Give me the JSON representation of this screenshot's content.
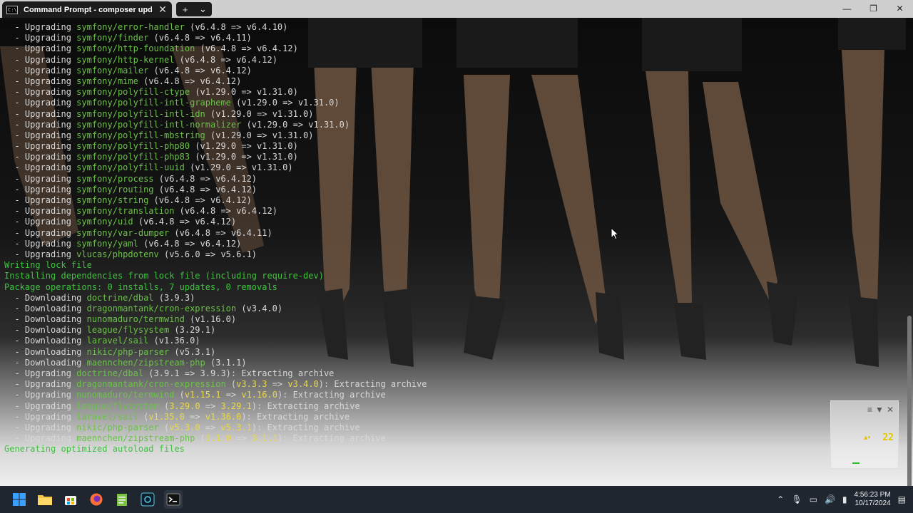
{
  "window": {
    "tab_title": "Command Prompt - composer  update",
    "tab_icon_text": "C:\\",
    "tab_close": "✕",
    "new_tab": "+",
    "tab_menu": "⌄",
    "minimize": "—",
    "maximize": "❐",
    "close": "✕"
  },
  "colors": {
    "package_green": "#6cc14a",
    "status_green": "#3fc33f",
    "version_yellow": "#e8d84a",
    "text_white": "#d8d8d8"
  },
  "terminal": {
    "lines": [
      [
        {
          "t": "  - Upgrading ",
          "c": "w"
        },
        {
          "t": "symfony/error-handler",
          "c": "g"
        },
        {
          "t": " (v6.4.8 => v6.4.10)",
          "c": "w"
        }
      ],
      [
        {
          "t": "  - Upgrading ",
          "c": "w"
        },
        {
          "t": "symfony/finder",
          "c": "g"
        },
        {
          "t": " (v6.4.8 => v6.4.11)",
          "c": "w"
        }
      ],
      [
        {
          "t": "  - Upgrading ",
          "c": "w"
        },
        {
          "t": "symfony/http-foundation",
          "c": "g"
        },
        {
          "t": " (v6.4.8 => v6.4.12)",
          "c": "w"
        }
      ],
      [
        {
          "t": "  - Upgrading ",
          "c": "w"
        },
        {
          "t": "symfony/http-kernel",
          "c": "g"
        },
        {
          "t": " (v6.4.8 => v6.4.12)",
          "c": "w"
        }
      ],
      [
        {
          "t": "  - Upgrading ",
          "c": "w"
        },
        {
          "t": "symfony/mailer",
          "c": "g"
        },
        {
          "t": " (v6.4.8 => v6.4.12)",
          "c": "w"
        }
      ],
      [
        {
          "t": "  - Upgrading ",
          "c": "w"
        },
        {
          "t": "symfony/mime",
          "c": "g"
        },
        {
          "t": " (v6.4.8 => v6.4.12)",
          "c": "w"
        }
      ],
      [
        {
          "t": "  - Upgrading ",
          "c": "w"
        },
        {
          "t": "symfony/polyfill-ctype",
          "c": "g"
        },
        {
          "t": " (v1.29.0 => v1.31.0)",
          "c": "w"
        }
      ],
      [
        {
          "t": "  - Upgrading ",
          "c": "w"
        },
        {
          "t": "symfony/polyfill-intl-grapheme",
          "c": "g"
        },
        {
          "t": " (v1.29.0 => v1.31.0)",
          "c": "w"
        }
      ],
      [
        {
          "t": "  - Upgrading ",
          "c": "w"
        },
        {
          "t": "symfony/polyfill-intl-idn",
          "c": "g"
        },
        {
          "t": " (v1.29.0 => v1.31.0)",
          "c": "w"
        }
      ],
      [
        {
          "t": "  - Upgrading ",
          "c": "w"
        },
        {
          "t": "symfony/polyfill-intl-normalizer",
          "c": "g"
        },
        {
          "t": " (v1.29.0 => v1.31.0)",
          "c": "w"
        }
      ],
      [
        {
          "t": "  - Upgrading ",
          "c": "w"
        },
        {
          "t": "symfony/polyfill-mbstring",
          "c": "g"
        },
        {
          "t": " (v1.29.0 => v1.31.0)",
          "c": "w"
        }
      ],
      [
        {
          "t": "  - Upgrading ",
          "c": "w"
        },
        {
          "t": "symfony/polyfill-php80",
          "c": "g"
        },
        {
          "t": " (v1.29.0 => v1.31.0)",
          "c": "w"
        }
      ],
      [
        {
          "t": "  - Upgrading ",
          "c": "w"
        },
        {
          "t": "symfony/polyfill-php83",
          "c": "g"
        },
        {
          "t": " (v1.29.0 => v1.31.0)",
          "c": "w"
        }
      ],
      [
        {
          "t": "  - Upgrading ",
          "c": "w"
        },
        {
          "t": "symfony/polyfill-uuid",
          "c": "g"
        },
        {
          "t": " (v1.29.0 => v1.31.0)",
          "c": "w"
        }
      ],
      [
        {
          "t": "  - Upgrading ",
          "c": "w"
        },
        {
          "t": "symfony/process",
          "c": "g"
        },
        {
          "t": " (v6.4.8 => v6.4.12)",
          "c": "w"
        }
      ],
      [
        {
          "t": "  - Upgrading ",
          "c": "w"
        },
        {
          "t": "symfony/routing",
          "c": "g"
        },
        {
          "t": " (v6.4.8 => v6.4.12)",
          "c": "w"
        }
      ],
      [
        {
          "t": "  - Upgrading ",
          "c": "w"
        },
        {
          "t": "symfony/string",
          "c": "g"
        },
        {
          "t": " (v6.4.8 => v6.4.12)",
          "c": "w"
        }
      ],
      [
        {
          "t": "  - Upgrading ",
          "c": "w"
        },
        {
          "t": "symfony/translation",
          "c": "g"
        },
        {
          "t": " (v6.4.8 => v6.4.12)",
          "c": "w"
        }
      ],
      [
        {
          "t": "  - Upgrading ",
          "c": "w"
        },
        {
          "t": "symfony/uid",
          "c": "g"
        },
        {
          "t": " (v6.4.8 => v6.4.12)",
          "c": "w"
        }
      ],
      [
        {
          "t": "  - Upgrading ",
          "c": "w"
        },
        {
          "t": "symfony/var-dumper",
          "c": "g"
        },
        {
          "t": " (v6.4.8 => v6.4.11)",
          "c": "w"
        }
      ],
      [
        {
          "t": "  - Upgrading ",
          "c": "w"
        },
        {
          "t": "symfony/yaml",
          "c": "g"
        },
        {
          "t": " (v6.4.8 => v6.4.12)",
          "c": "w"
        }
      ],
      [
        {
          "t": "  - Upgrading ",
          "c": "w"
        },
        {
          "t": "vlucas/phpdotenv",
          "c": "g"
        },
        {
          "t": " (v5.6.0 => v5.6.1)",
          "c": "w"
        }
      ],
      [
        {
          "t": "Writing lock file",
          "c": "s"
        }
      ],
      [
        {
          "t": "Installing dependencies from lock file (including require-dev)",
          "c": "s"
        }
      ],
      [
        {
          "t": "Package operations: 0 installs, 7 updates, 0 removals",
          "c": "s"
        }
      ],
      [
        {
          "t": "  - Downloading ",
          "c": "w"
        },
        {
          "t": "doctrine/dbal",
          "c": "g"
        },
        {
          "t": " (3.9.3)",
          "c": "w"
        }
      ],
      [
        {
          "t": "  - Downloading ",
          "c": "w"
        },
        {
          "t": "dragonmantank/cron-expression",
          "c": "g"
        },
        {
          "t": " (v3.4.0)",
          "c": "w"
        }
      ],
      [
        {
          "t": "  - Downloading ",
          "c": "w"
        },
        {
          "t": "nunomaduro/termwind",
          "c": "g"
        },
        {
          "t": " (v1.16.0)",
          "c": "w"
        }
      ],
      [
        {
          "t": "  - Downloading ",
          "c": "w"
        },
        {
          "t": "league/flysystem",
          "c": "g"
        },
        {
          "t": " (3.29.1)",
          "c": "w"
        }
      ],
      [
        {
          "t": "  - Downloading ",
          "c": "w"
        },
        {
          "t": "laravel/sail",
          "c": "g"
        },
        {
          "t": " (v1.36.0)",
          "c": "w"
        }
      ],
      [
        {
          "t": "  - Downloading ",
          "c": "w"
        },
        {
          "t": "nikic/php-parser",
          "c": "g"
        },
        {
          "t": " (v5.3.1)",
          "c": "w"
        }
      ],
      [
        {
          "t": "  - Downloading ",
          "c": "w"
        },
        {
          "t": "maennchen/zipstream-php",
          "c": "g"
        },
        {
          "t": " (3.1.1)",
          "c": "w"
        }
      ],
      [
        {
          "t": "  - Upgrading ",
          "c": "w"
        },
        {
          "t": "doctrine/dbal",
          "c": "g"
        },
        {
          "t": " (3.9.1 => 3.9.3)",
          "c": "w"
        },
        {
          "t": ": Extracting archive",
          "c": "w"
        }
      ],
      [
        {
          "t": "  - Upgrading ",
          "c": "w"
        },
        {
          "t": "dragonmantank/cron-expression",
          "c": "g"
        },
        {
          "t": " (",
          "c": "w"
        },
        {
          "t": "v3.3.3",
          "c": "y"
        },
        {
          "t": " => ",
          "c": "w"
        },
        {
          "t": "v3.4.0",
          "c": "y"
        },
        {
          "t": "): Extracting archive",
          "c": "w"
        }
      ],
      [
        {
          "t": "  - Upgrading ",
          "c": "w"
        },
        {
          "t": "nunomaduro/termwind",
          "c": "g"
        },
        {
          "t": " (",
          "c": "w"
        },
        {
          "t": "v1.15.1",
          "c": "y"
        },
        {
          "t": " => ",
          "c": "w"
        },
        {
          "t": "v1.16.0",
          "c": "y"
        },
        {
          "t": "): Extracting archive",
          "c": "w"
        }
      ],
      [
        {
          "t": "  - Upgrading ",
          "c": "w"
        },
        {
          "t": "league/flysystem",
          "c": "g"
        },
        {
          "t": " (",
          "c": "w"
        },
        {
          "t": "3.29.0",
          "c": "y"
        },
        {
          "t": " => ",
          "c": "w"
        },
        {
          "t": "3.29.1",
          "c": "y"
        },
        {
          "t": "): Extracting archive",
          "c": "w"
        }
      ],
      [
        {
          "t": "  - Upgrading ",
          "c": "w"
        },
        {
          "t": "laravel/sail",
          "c": "g"
        },
        {
          "t": " (",
          "c": "w"
        },
        {
          "t": "v1.35.0",
          "c": "y"
        },
        {
          "t": " => ",
          "c": "w"
        },
        {
          "t": "v1.36.0",
          "c": "y"
        },
        {
          "t": "): Extracting archive",
          "c": "w"
        }
      ],
      [
        {
          "t": "  - Upgrading ",
          "c": "w"
        },
        {
          "t": "nikic/php-parser",
          "c": "g"
        },
        {
          "t": " (",
          "c": "w"
        },
        {
          "t": "v5.3.0",
          "c": "y"
        },
        {
          "t": " => ",
          "c": "w"
        },
        {
          "t": "v5.3.1",
          "c": "y"
        },
        {
          "t": "): Extracting archive",
          "c": "w"
        }
      ],
      [
        {
          "t": "  - Upgrading ",
          "c": "w"
        },
        {
          "t": "maennchen/zipstream-php",
          "c": "g"
        },
        {
          "t": " (",
          "c": "w"
        },
        {
          "t": "3.1.0",
          "c": "y"
        },
        {
          "t": " => ",
          "c": "w"
        },
        {
          "t": "3.1.1",
          "c": "y"
        },
        {
          "t": "): Extracting archive",
          "c": "w"
        }
      ],
      [
        {
          "t": "Generating optimized autoload files",
          "c": "s"
        }
      ]
    ]
  },
  "widget": {
    "menu_icon": "≡",
    "collapse_icon": "▼",
    "close_icon": "✕",
    "value": "22",
    "marker": "▴▪"
  },
  "taskbar": {
    "apps": [
      "start-icon",
      "file-explorer-icon",
      "store-icon",
      "firefox-icon",
      "notepad-icon",
      "app-icon",
      "terminal-icon"
    ],
    "time": "4:56:23 PM",
    "date": "10/17/2024"
  }
}
